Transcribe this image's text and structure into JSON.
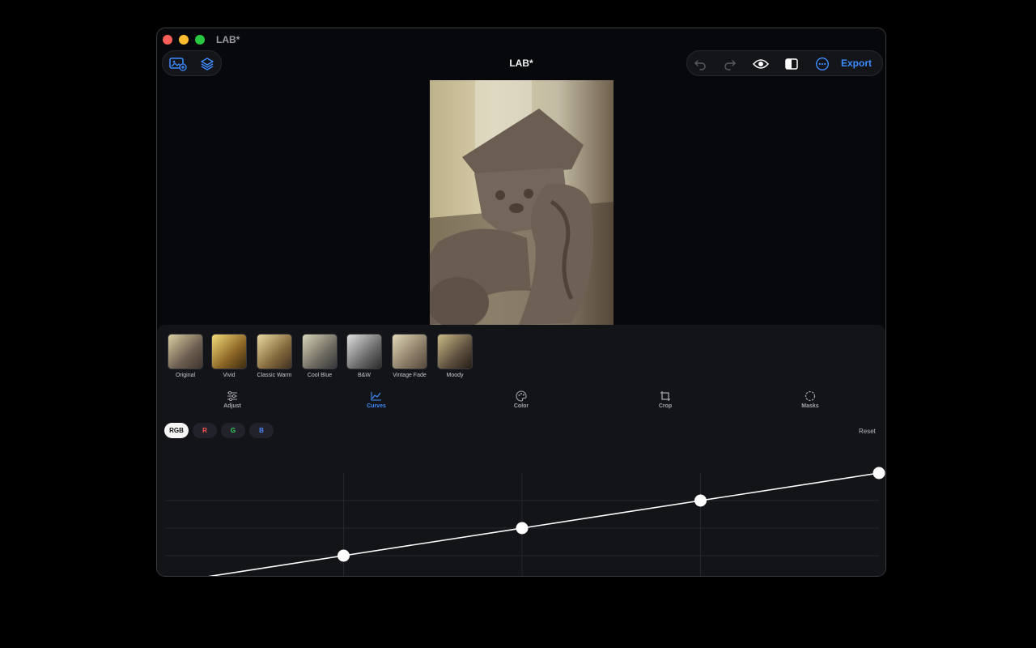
{
  "window": {
    "title": "LAB*"
  },
  "toolbar": {
    "title": "LAB*",
    "export_label": "Export",
    "left_icons": [
      "add-photo-icon",
      "layers-icon"
    ],
    "right_icons": [
      "undo-icon",
      "redo-icon",
      "eye-icon",
      "compare-icon",
      "more-icon"
    ]
  },
  "presets": [
    {
      "label": "Original"
    },
    {
      "label": "Vivid"
    },
    {
      "label": "Classic Warm"
    },
    {
      "label": "Cool Blue"
    },
    {
      "label": "B&W"
    },
    {
      "label": "Vintage Fade"
    },
    {
      "label": "Moody"
    }
  ],
  "tabs": [
    {
      "label": "Adjust",
      "icon": "sliders-icon"
    },
    {
      "label": "Curves",
      "icon": "curves-icon",
      "active": true
    },
    {
      "label": "Color",
      "icon": "palette-icon"
    },
    {
      "label": "Crop",
      "icon": "crop-icon"
    },
    {
      "label": "Masks",
      "icon": "mask-circle-icon"
    }
  ],
  "curves": {
    "channels": [
      {
        "label": "RGB",
        "active": true,
        "color": "#111111"
      },
      {
        "label": "R",
        "color": "#ff5a4e"
      },
      {
        "label": "G",
        "color": "#35d05a"
      },
      {
        "label": "B",
        "color": "#4a86ff"
      }
    ],
    "reset_label": "Reset",
    "points": [
      [
        0,
        0
      ],
      [
        0.25,
        0.25
      ],
      [
        0.5,
        0.5
      ],
      [
        0.75,
        0.75
      ],
      [
        1,
        1
      ]
    ]
  },
  "colors": {
    "accent": "#3d8cff",
    "panel": "#131418",
    "background": "#07080b"
  }
}
